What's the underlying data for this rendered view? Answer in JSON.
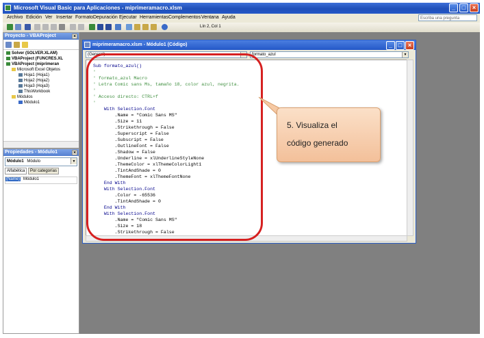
{
  "window": {
    "title": "Microsoft Visual Basic para Aplicaciones - miprimeramacro.xlsm",
    "controls": [
      "_",
      "□",
      "×"
    ]
  },
  "menubar": {
    "items": [
      "Archivo",
      "Edición",
      "Ver",
      "Insertar",
      "Formato",
      "Depuración",
      "Ejecutar",
      "Herramientas",
      "Complementos",
      "Ventana",
      "Ayuda"
    ],
    "help_placeholder": "Escriba una pregunta"
  },
  "toolbar": {
    "position": "Lín 2, Col 1"
  },
  "project_pane": {
    "title": "Proyecto - VBAProject",
    "tree": [
      "Solver (SOLVER.XLAM)",
      "VBAProject (FUNCRES.XL",
      "VBAProject (miprimeran",
      "Microsoft Excel Objetos",
      "Hoja1 (Hoja1)",
      "Hoja2 (Hoja2)",
      "Hoja3 (Hoja3)",
      "ThisWorkbook",
      "Módulos",
      "Módulo1"
    ]
  },
  "props_pane": {
    "title": "Propiedades - Módulo1",
    "object_name": "Módulo1",
    "object_type": "Módulo",
    "tabs": [
      "Alfabética",
      "Por categorías"
    ],
    "row_name": "(Name)",
    "row_value": "Módulo1"
  },
  "code_window": {
    "title": "miprimeramacro.xlsm - Módulo1 (Código)",
    "object_combo": "(General)",
    "proc_combo": "formato_azul",
    "lines": [
      "Sub formato_azul()",
      "'",
      "' formato_azul Macro",
      "' Letra Comic sans Ms, tamaño 18, color azul, negrita.",
      "'",
      "' Acceso directo: CTRL+f",
      "'",
      "    With Selection.Font",
      "        .Name = \"Comic Sans MS\"",
      "        .Size = 11",
      "        .Strikethrough = False",
      "        .Superscript = False",
      "        .Subscript = False",
      "        .OutlineFont = False",
      "        .Shadow = False",
      "        .Underline = xlUnderlineStyleNone",
      "        .ThemeColor = xlThemeColorLight1",
      "        .TintAndShade = 0",
      "        .ThemeFont = xlThemeFontNone",
      "    End With",
      "    With Selection.Font",
      "        .Color = -65536",
      "        .TintAndShade = 0",
      "    End With",
      "    With Selection.Font",
      "        .Name = \"Comic Sans MS\"",
      "        .Size = 18",
      "        .Strikethrough = False"
    ]
  },
  "callout": {
    "line1": "5. Visualiza el",
    "line2": "código generado"
  },
  "colors": {
    "title_blue": "#2458c8",
    "annotation_red": "#d62020",
    "callout_fill": "#f6c9a4",
    "comment_green": "#3f8f3f",
    "keyword_blue": "#00008b"
  }
}
